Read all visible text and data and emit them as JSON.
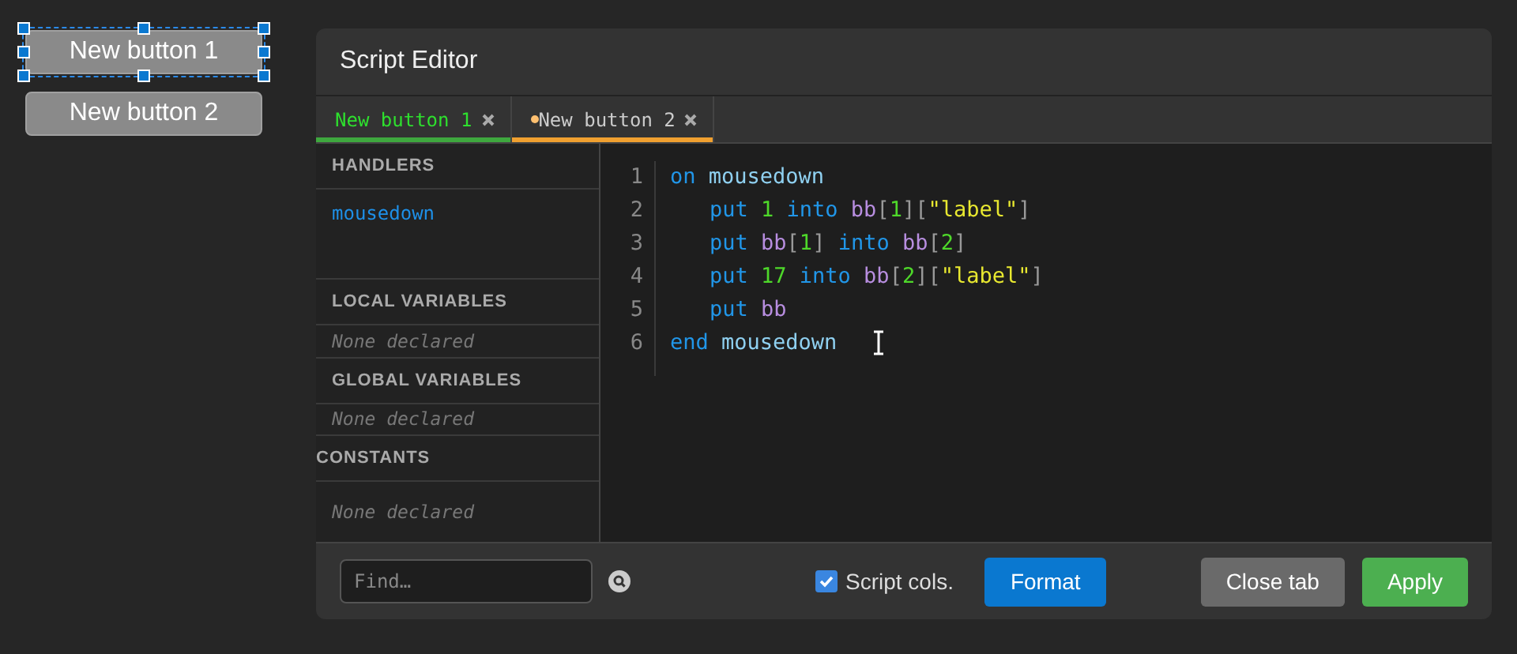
{
  "canvas_buttons": [
    {
      "label": "New button 1",
      "selected": true
    },
    {
      "label": "New button 2",
      "selected": false
    }
  ],
  "editor": {
    "title": "Script Editor",
    "tabs": [
      {
        "label": "New button 1",
        "selected": true,
        "modified": false
      },
      {
        "label": "New button 2",
        "selected": false,
        "modified": true
      }
    ],
    "sidebar": [
      {
        "heading": "HANDLERS",
        "kind": "list",
        "items": [
          {
            "label": "mousedown"
          }
        ]
      },
      {
        "heading": "LOCAL VARIABLES",
        "kind": "empty",
        "text": "None declared"
      },
      {
        "heading": "GLOBAL VARIABLES",
        "kind": "empty",
        "text": "None declared"
      },
      {
        "heading": "CONSTANTS",
        "kind": "empty",
        "text": "None declared"
      }
    ],
    "code": [
      {
        "number": "1",
        "indent": false,
        "words": [
          [
            {
              "text": "on",
              "kind": "keyword"
            }
          ],
          [
            {
              "text": "mousedown",
              "kind": "name"
            }
          ]
        ]
      },
      {
        "number": "2",
        "indent": true,
        "words": [
          [
            {
              "text": "put",
              "kind": "keyword"
            }
          ],
          [
            {
              "text": "1",
              "kind": "number"
            }
          ],
          [
            {
              "text": "into",
              "kind": "keyword"
            }
          ],
          [
            {
              "text": "bb",
              "kind": "variable"
            },
            {
              "text": "[",
              "kind": "bracket"
            },
            {
              "text": "1",
              "kind": "number"
            },
            {
              "text": "][",
              "kind": "bracket"
            },
            {
              "text": "\"label\"",
              "kind": "string"
            },
            {
              "text": "]",
              "kind": "bracket"
            }
          ]
        ]
      },
      {
        "number": "3",
        "indent": true,
        "words": [
          [
            {
              "text": "put",
              "kind": "keyword"
            }
          ],
          [
            {
              "text": "bb",
              "kind": "variable"
            },
            {
              "text": "[",
              "kind": "bracket"
            },
            {
              "text": "1",
              "kind": "number"
            },
            {
              "text": "]",
              "kind": "bracket"
            }
          ],
          [
            {
              "text": "into",
              "kind": "keyword"
            }
          ],
          [
            {
              "text": "bb",
              "kind": "variable"
            },
            {
              "text": "[",
              "kind": "bracket"
            },
            {
              "text": "2",
              "kind": "number"
            },
            {
              "text": "]",
              "kind": "bracket"
            }
          ]
        ]
      },
      {
        "number": "4",
        "indent": true,
        "words": [
          [
            {
              "text": "put",
              "kind": "keyword"
            }
          ],
          [
            {
              "text": "17",
              "kind": "number"
            }
          ],
          [
            {
              "text": "into",
              "kind": "keyword"
            }
          ],
          [
            {
              "text": "bb",
              "kind": "variable"
            },
            {
              "text": "[",
              "kind": "bracket"
            },
            {
              "text": "2",
              "kind": "number"
            },
            {
              "text": "][",
              "kind": "bracket"
            },
            {
              "text": "\"label\"",
              "kind": "string"
            },
            {
              "text": "]",
              "kind": "bracket"
            }
          ]
        ]
      },
      {
        "number": "5",
        "indent": true,
        "words": [
          [
            {
              "text": "put",
              "kind": "keyword"
            }
          ],
          [
            {
              "text": "bb",
              "kind": "variable"
            }
          ]
        ]
      },
      {
        "number": "6",
        "indent": false,
        "words": [
          [
            {
              "text": "end",
              "kind": "keyword"
            }
          ],
          [
            {
              "text": "mousedown",
              "kind": "name"
            }
          ]
        ]
      }
    ],
    "footer": {
      "find": {
        "placeholder": "Find…"
      },
      "script_cols": {
        "label": "Script cols.",
        "checked": true
      },
      "buttons": [
        {
          "label": "Format",
          "kind": "primary"
        },
        {
          "label": "Close tab",
          "kind": "secondary"
        },
        {
          "label": "Apply",
          "kind": "success"
        }
      ]
    }
  }
}
